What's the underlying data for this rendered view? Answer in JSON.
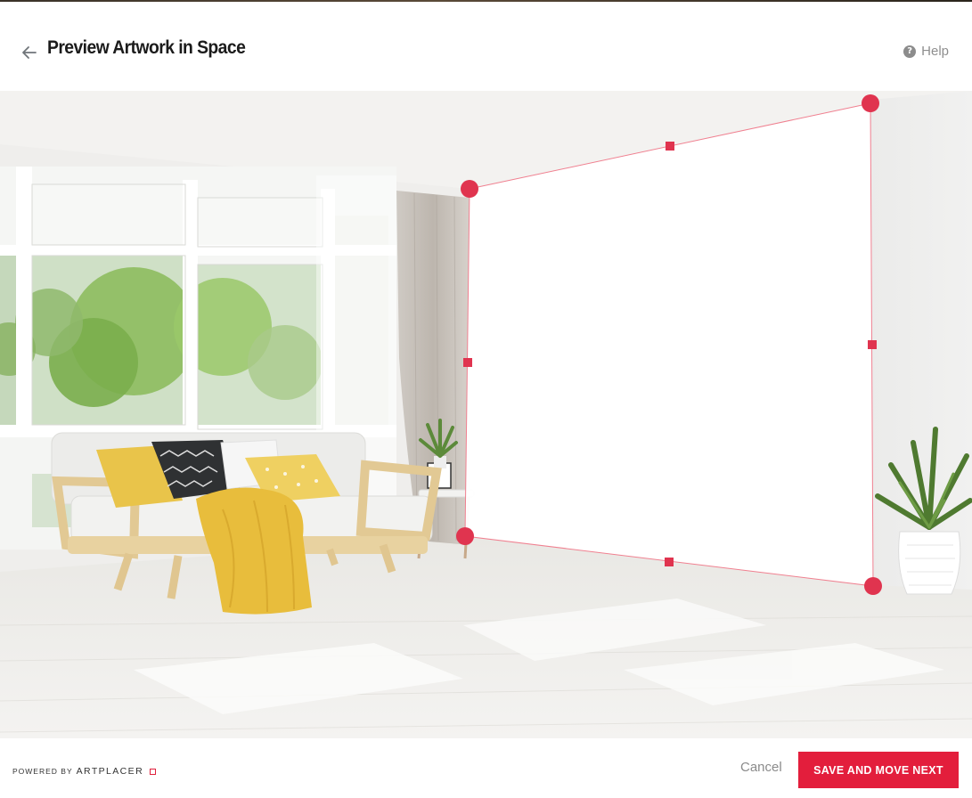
{
  "header": {
    "title": "Preview Artwork in Space",
    "help_label": "Help",
    "help_icon": "?"
  },
  "footer": {
    "powered_by": "POWERED BY",
    "brand": "ARTPLACER",
    "cancel_label": "Cancel",
    "save_label": "SAVE AND MOVE NEXT"
  },
  "colors": {
    "accent": "#e31e3c",
    "handle": "#e0344f",
    "wall_frame": "#ffffff"
  },
  "icons": {
    "back": "arrow-left-icon",
    "help": "question-circle-icon",
    "brand": "square-outline-icon"
  }
}
